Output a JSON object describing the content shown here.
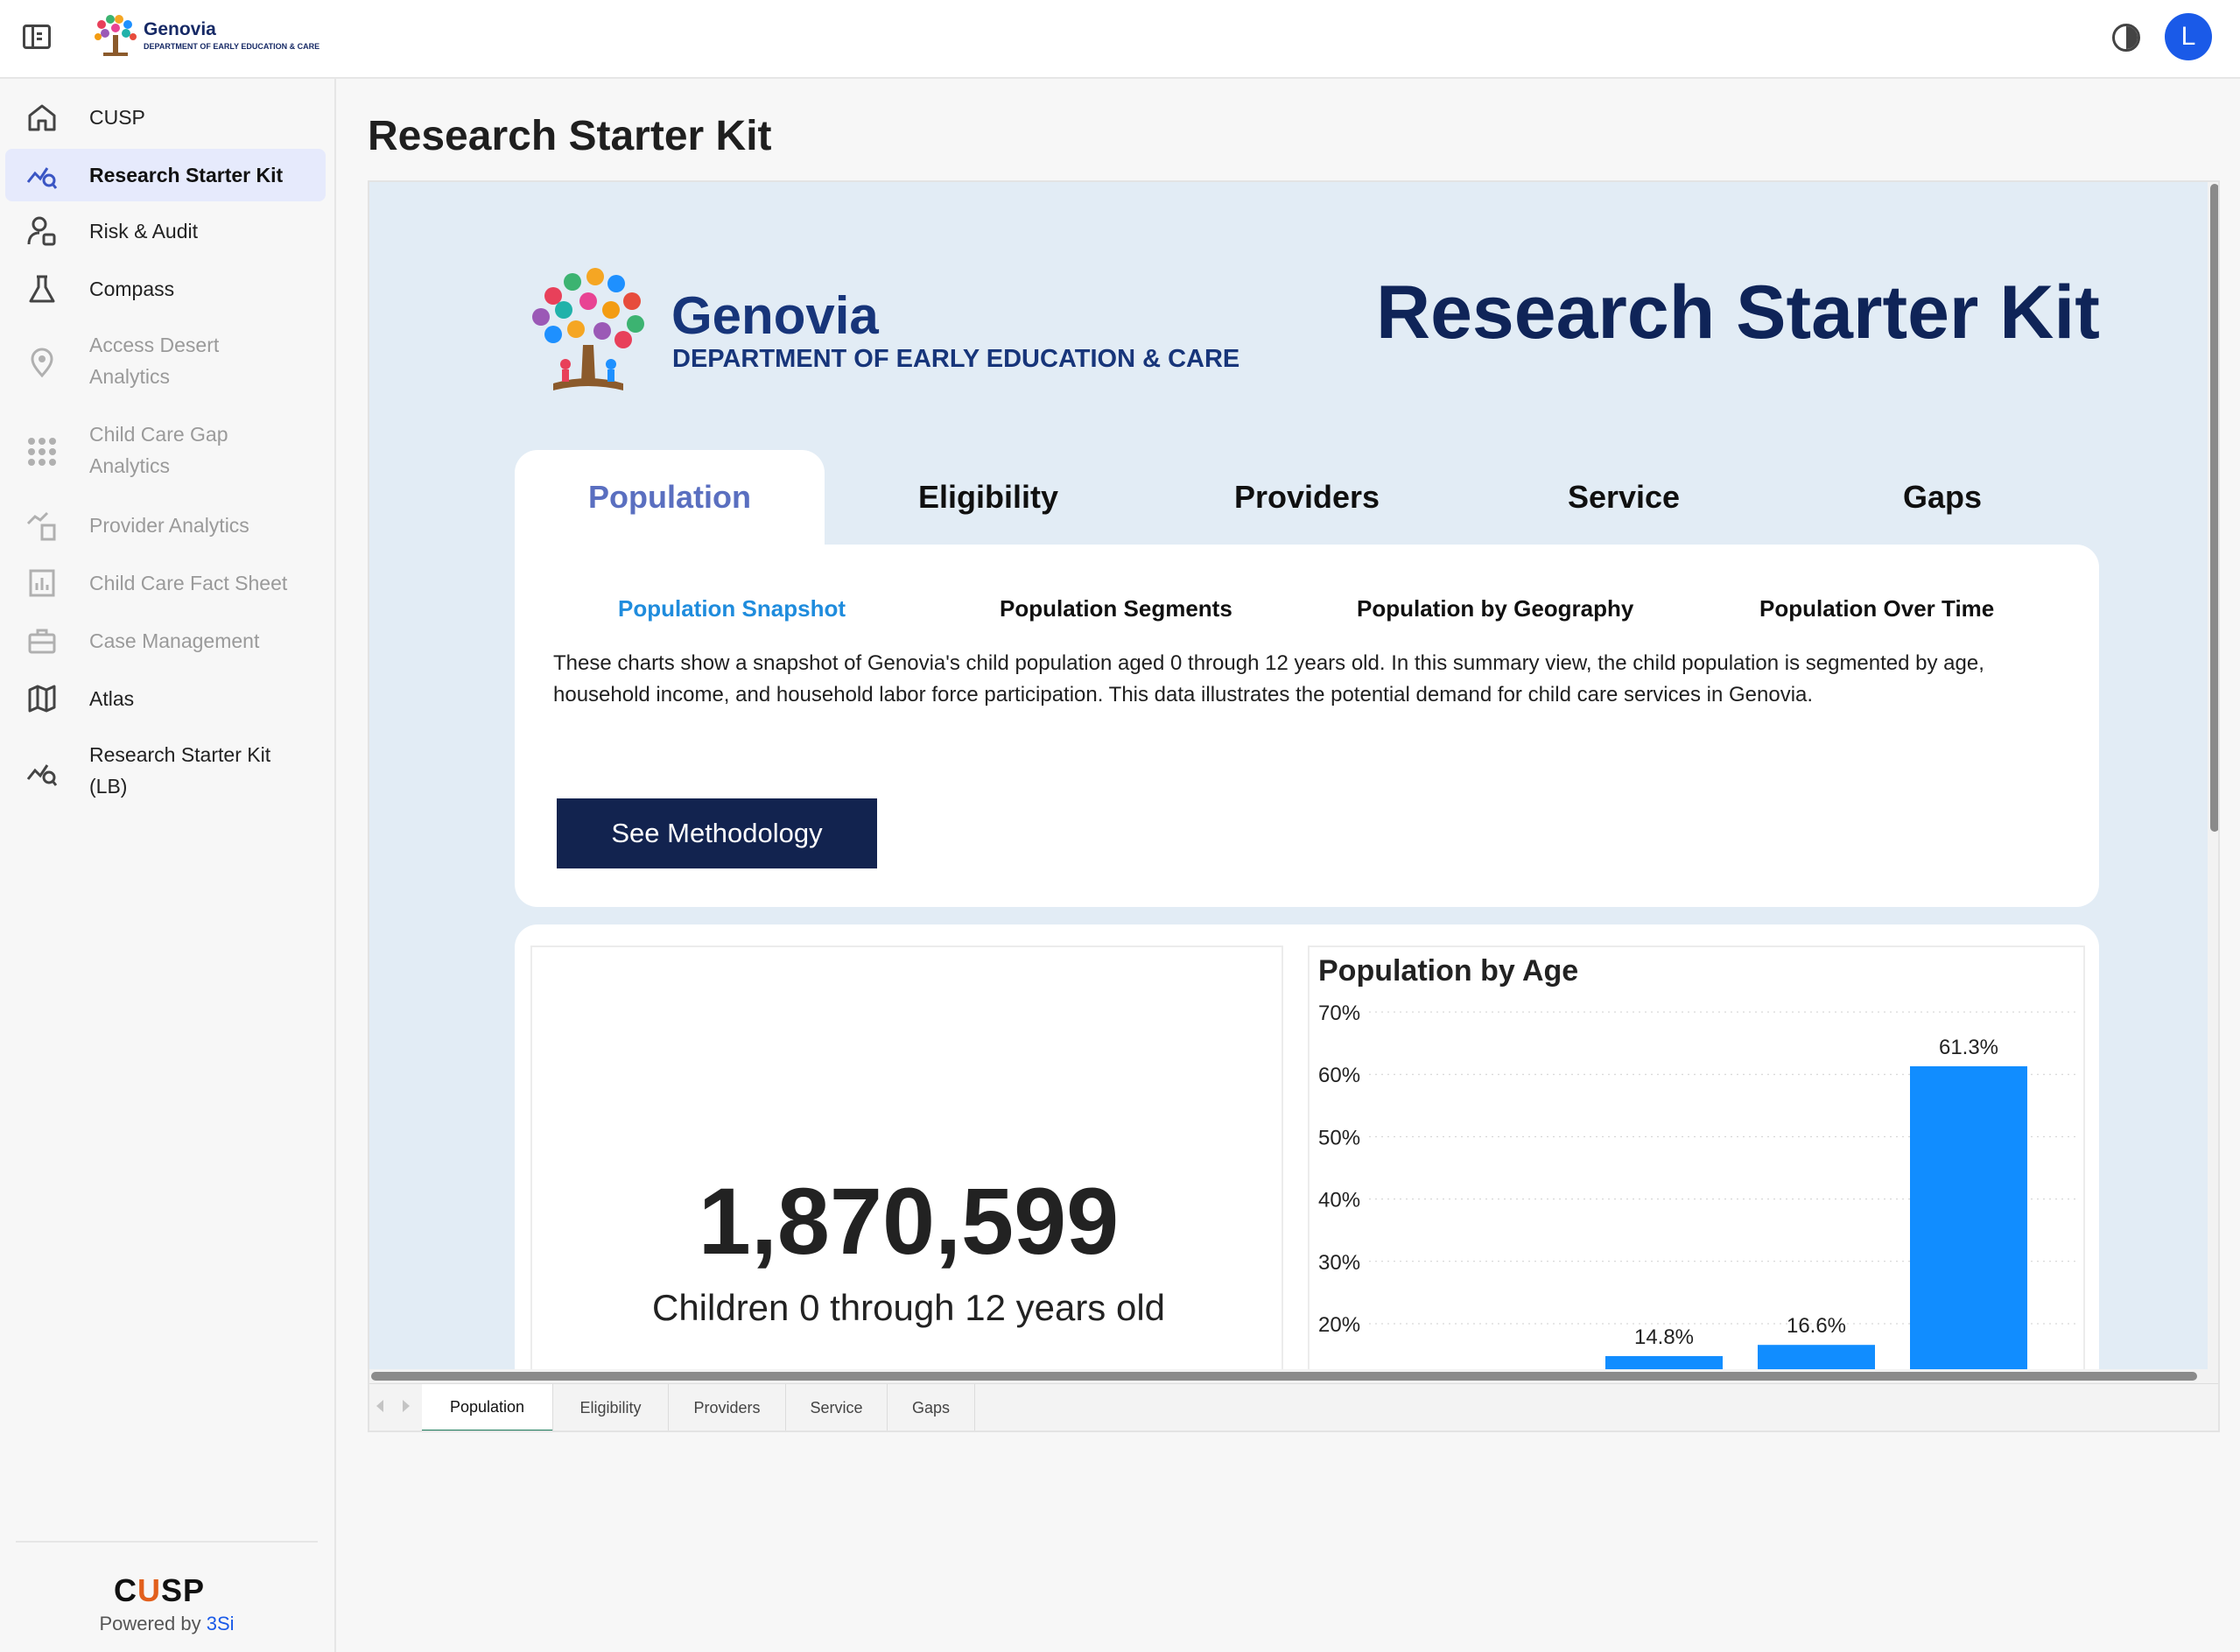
{
  "app": {
    "brand": "Genovia",
    "dept": "DEPARTMENT OF EARLY EDUCATION & CARE",
    "user_initial": "L",
    "accent_color": "#1a5ae8"
  },
  "sidebar": {
    "items": [
      {
        "label": "CUSP",
        "icon": "home-icon",
        "state": "normal"
      },
      {
        "label": "Research Starter Kit",
        "icon": "chart-search-icon",
        "state": "active"
      },
      {
        "label": "Risk & Audit",
        "icon": "user-shield-icon",
        "state": "normal"
      },
      {
        "label": "Compass",
        "icon": "flask-icon",
        "state": "normal"
      },
      {
        "label": "Access Desert Analytics",
        "icon": "location-pin-icon",
        "state": "disabled"
      },
      {
        "label": "Child Care Gap Analytics",
        "icon": "grid-dots-icon",
        "state": "disabled"
      },
      {
        "label": "Provider Analytics",
        "icon": "chart-building-icon",
        "state": "disabled"
      },
      {
        "label": "Child Care Fact Sheet",
        "icon": "report-icon",
        "state": "disabled"
      },
      {
        "label": "Case Management",
        "icon": "briefcase-icon",
        "state": "disabled"
      },
      {
        "label": "Atlas",
        "icon": "map-icon",
        "state": "normal"
      },
      {
        "label": "Research Starter Kit (LB)",
        "icon": "chart-search-icon",
        "state": "normal"
      }
    ],
    "footer": {
      "logo_left": "C",
      "logo_accent": "U",
      "logo_right": "SP",
      "powered_prefix": "Powered by",
      "powered_link": "3Si"
    }
  },
  "page": {
    "title": "Research Starter Kit"
  },
  "report": {
    "brand": "Genovia",
    "dept": "DEPARTMENT OF EARLY EDUCATION & CARE",
    "title": "Research Starter Kit",
    "tabs": [
      "Population",
      "Eligibility",
      "Providers",
      "Service",
      "Gaps"
    ],
    "active_tab": 0,
    "subtabs": [
      "Population Snapshot",
      "Population Segments",
      "Population by Geography",
      "Population Over Time"
    ],
    "active_subtab": 0,
    "description": "These charts show a snapshot of Genovia's child population aged 0 through 12 years old. In this summary view, the child population is segmented by age, household income, and household labor force participation. This data illustrates the potential demand for child care services in Genovia.",
    "methodology_button": "See Methodology",
    "kpi": {
      "value": "1,870,599",
      "label": "Children 0 through 12 years old"
    },
    "page_tabs": [
      "Population",
      "Eligibility",
      "Providers",
      "Service",
      "Gaps"
    ],
    "active_page_tab": 0,
    "colors": {
      "navy": "#12234f",
      "banner_bg": "#e2ecf5",
      "active_tab": "#5a6fc0",
      "active_subtab": "#1f8cdd",
      "bar": "#118dff"
    }
  },
  "chart_data": {
    "type": "bar",
    "title": "Population by Age",
    "categories": [
      "",
      "",
      "",
      ""
    ],
    "values": [
      null,
      14.8,
      16.6,
      61.3
    ],
    "data_labels": [
      "",
      "14.8%",
      "16.6%",
      "61.3%"
    ],
    "y_ticks": [
      "20%",
      "30%",
      "40%",
      "50%",
      "60%",
      "70%"
    ],
    "ylim": [
      0,
      70
    ],
    "grid": true,
    "bar_color": "#118dff"
  }
}
